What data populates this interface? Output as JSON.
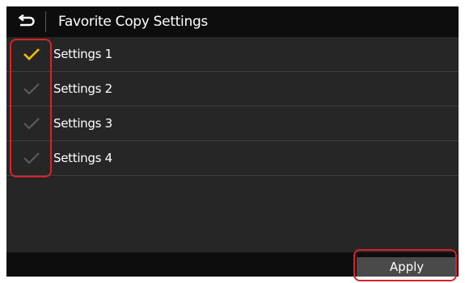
{
  "header": {
    "title": "Favorite Copy Settings",
    "back_icon": "back-arrow-icon"
  },
  "list": {
    "items": [
      {
        "label": "Settings 1",
        "selected": true
      },
      {
        "label": "Settings 2",
        "selected": false
      },
      {
        "label": "Settings 3",
        "selected": false
      },
      {
        "label": "Settings 4",
        "selected": false
      }
    ]
  },
  "footer": {
    "apply_label": "Apply"
  },
  "colors": {
    "screen_bg": "#262626",
    "bar_bg": "#0d0d0d",
    "check_selected": "#f2c200",
    "check_unselected": "#5a5a5a",
    "annotation": "#d8232a"
  }
}
